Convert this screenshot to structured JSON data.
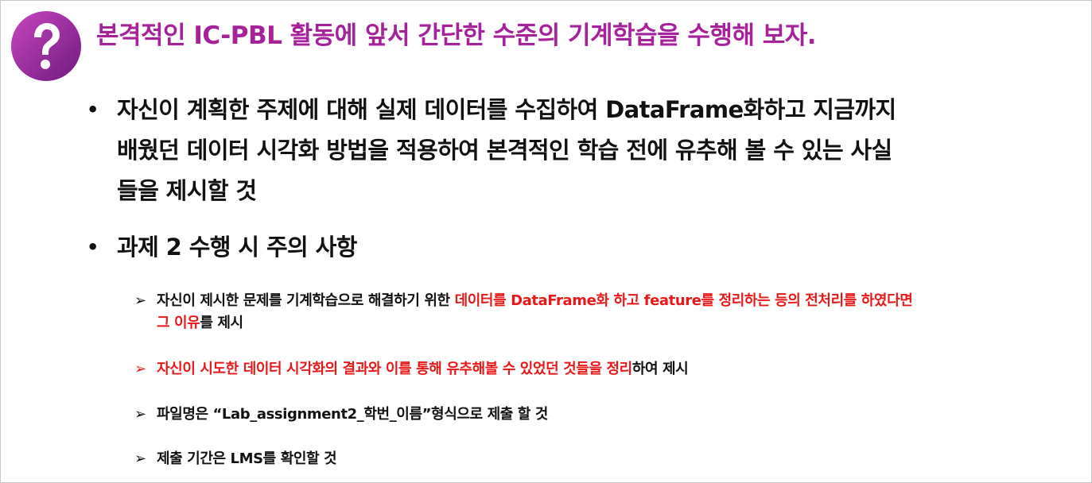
{
  "header": {
    "icon": "question-mark-icon",
    "title": "본격적인 IC-PBL 활동에 앞서 간단한 수준의 기계학습을 수행해 보자."
  },
  "bullets": [
    {
      "marker": "•",
      "line1": "자신이 계획한 주제에 대해 실제 데이터를 수집하여 DataFrame화하고 지금까지",
      "line2": "배웠던 데이터 시각화 방법을 적용하여 본격적인 학습 전에 유추해 볼 수 있는 사실",
      "line3": "들을 제시할 것"
    },
    {
      "marker": "•",
      "text": "과제 2 수행 시 주의 사항"
    }
  ],
  "sub_items": [
    {
      "marker": "➢",
      "part1": "자신이 제시한 문제를 기계학습으로 해결하기 위한 ",
      "part2_red": "데이터를 DataFrame화 하고 feature를 정리하는 등의 전처리를 하였다면",
      "part3_red": "그 이유",
      "part4": "를 제시"
    },
    {
      "marker": "➢",
      "part1_red": "자신이 시도한 데이터 시각화의 결과와 이를 통해 유추해볼 수 있었던 것들을 정리",
      "part2": "하여 제시"
    },
    {
      "marker": "➢",
      "text": "파일명은 “Lab_assignment2_학번_이름”형식으로 제출 할 것"
    },
    {
      "marker": "➢",
      "text": "제출 기간은 LMS를 확인할 것"
    }
  ],
  "colors": {
    "title": "#a6229a",
    "badge_light": "#b53cb0",
    "badge_dark": "#7a1a86",
    "highlight_red": "#e81818"
  }
}
